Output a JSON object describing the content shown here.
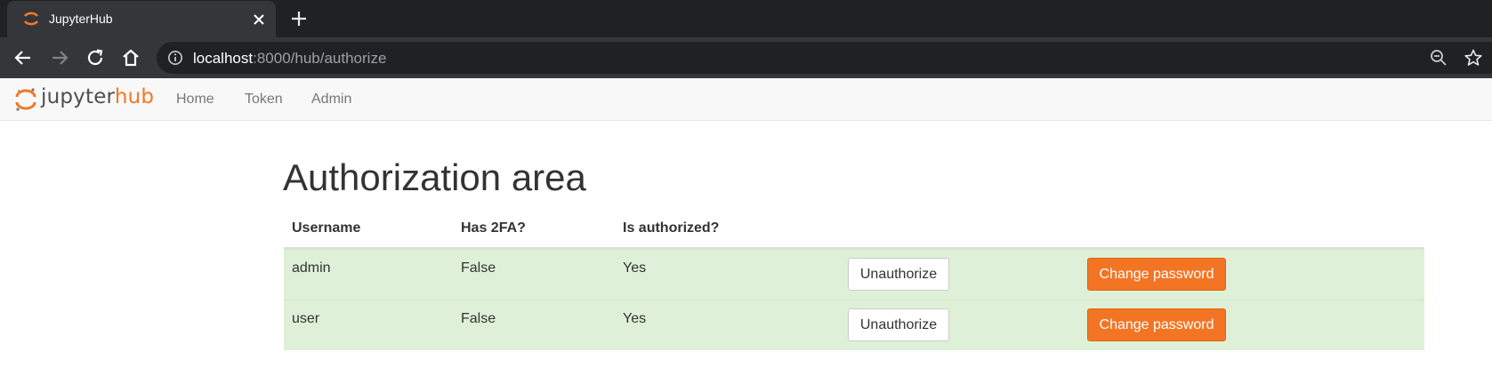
{
  "browser": {
    "tab_title": "JupyterHub",
    "url_host": "localhost",
    "url_rest": ":8000/hub/authorize"
  },
  "hub_nav": {
    "logo_jupyter": "jupyter",
    "logo_hub": "hub",
    "links": [
      {
        "label": "Home"
      },
      {
        "label": "Token"
      },
      {
        "label": "Admin"
      }
    ]
  },
  "main": {
    "title": "Authorization area",
    "table": {
      "headers": [
        "Username",
        "Has 2FA?",
        "Is authorized?"
      ],
      "rows": [
        {
          "username": "admin",
          "has_2fa": "False",
          "is_authorized": "Yes",
          "unauthorize_label": "Unauthorize",
          "change_password_label": "Change password"
        },
        {
          "username": "user",
          "has_2fa": "False",
          "is_authorized": "Yes",
          "unauthorize_label": "Unauthorize",
          "change_password_label": "Change password"
        }
      ]
    }
  },
  "colors": {
    "accent": "#f37726",
    "success_row": "#dff0d8",
    "browser_dark": "#202124"
  },
  "icons": [
    "jupyter-logo-icon",
    "close-icon",
    "plus-icon",
    "back-arrow-icon",
    "forward-arrow-icon",
    "reload-icon",
    "home-icon",
    "info-icon",
    "zoom-out-icon",
    "star-icon"
  ]
}
